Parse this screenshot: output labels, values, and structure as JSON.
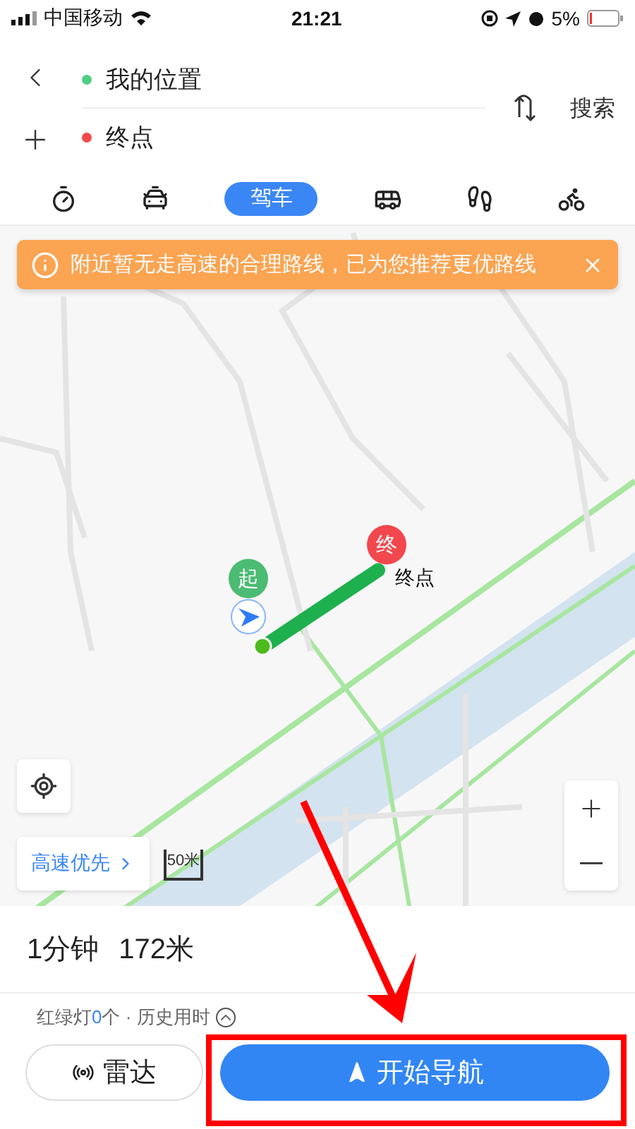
{
  "status_bar": {
    "carrier": "中国移动",
    "time": "21:21",
    "battery": "5%"
  },
  "route": {
    "origin": {
      "label": "我的位置",
      "color": "#4fcf86"
    },
    "destination": {
      "label": "终点",
      "color": "#f04a4a"
    },
    "search": "搜索"
  },
  "modes": [
    {
      "kind": "timer",
      "selected": false
    },
    {
      "kind": "taxi",
      "selected": false
    },
    {
      "label": "驾车",
      "selected": true
    },
    {
      "kind": "bus",
      "selected": false
    },
    {
      "kind": "walk",
      "selected": false
    },
    {
      "kind": "bike",
      "selected": false
    }
  ],
  "notice": {
    "text": "附近暂无走高速的合理路线，已为您推荐更优路线"
  },
  "map": {
    "start_marker": "起",
    "end_marker": "终",
    "end_label": "终点",
    "scale": "50米",
    "preference": "高速优先"
  },
  "summary": {
    "duration": "1分钟",
    "distance": "172米",
    "lights_prefix": "红绿灯",
    "lights_count": "0",
    "lights_suffix": "个 · 历史用时"
  },
  "buttons": {
    "radar": "雷达",
    "navigate": "开始导航"
  }
}
